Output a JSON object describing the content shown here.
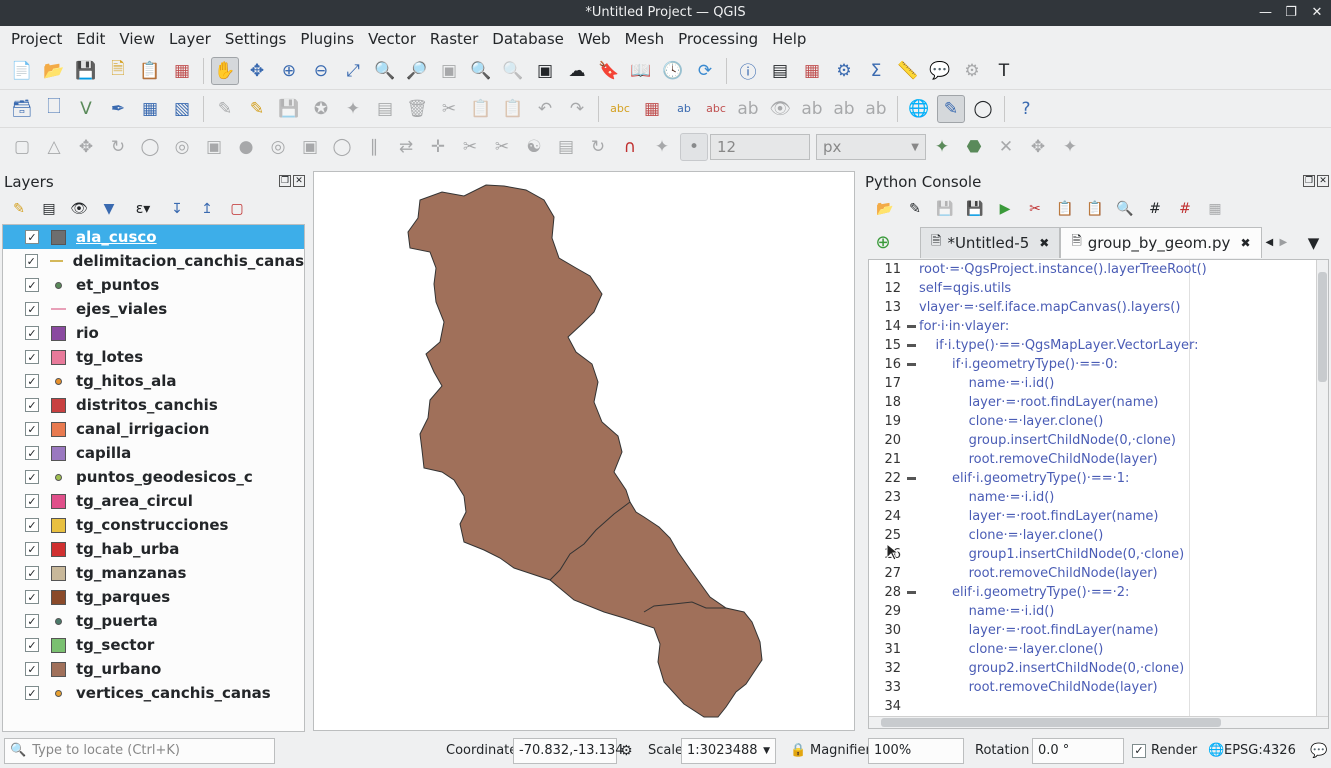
{
  "window": {
    "title": "*Untitled Project — QGIS"
  },
  "menu": [
    "Project",
    "Edit",
    "View",
    "Layer",
    "Settings",
    "Plugins",
    "Vector",
    "Raster",
    "Database",
    "Web",
    "Mesh",
    "Processing",
    "Help"
  ],
  "toolbar3": {
    "size_value": "12",
    "unit_value": "px"
  },
  "layers_panel": {
    "title": "Layers",
    "items": [
      {
        "name": "ala_cusco",
        "symbol": "fill",
        "color": "#6e6e6e",
        "selected": true
      },
      {
        "name": "delimitacion_canchis_canas",
        "symbol": "line",
        "color": "#d4b85a"
      },
      {
        "name": "et_puntos",
        "symbol": "point",
        "color": "#5a8a5a"
      },
      {
        "name": "ejes_viales",
        "symbol": "line",
        "color": "#e8a0b8"
      },
      {
        "name": "rio",
        "symbol": "fill",
        "color": "#8a4aa0"
      },
      {
        "name": "tg_lotes",
        "symbol": "fill",
        "color": "#e87a9a"
      },
      {
        "name": "tg_hitos_ala",
        "symbol": "point",
        "color": "#e8902a"
      },
      {
        "name": "distritos_canchis",
        "symbol": "fill",
        "color": "#c84040"
      },
      {
        "name": "canal_irrigacion",
        "symbol": "fill",
        "color": "#e87a50"
      },
      {
        "name": "capilla",
        "symbol": "fill",
        "color": "#9a78c0"
      },
      {
        "name": "puntos_geodesicos_c",
        "symbol": "point",
        "color": "#a0c050"
      },
      {
        "name": "tg_area_circul",
        "symbol": "fill",
        "color": "#e0508a"
      },
      {
        "name": "tg_construcciones",
        "symbol": "fill",
        "color": "#e8c040"
      },
      {
        "name": "tg_hab_urba",
        "symbol": "fill",
        "color": "#d03030"
      },
      {
        "name": "tg_manzanas",
        "symbol": "fill",
        "color": "#c8b89a"
      },
      {
        "name": "tg_parques",
        "symbol": "fill",
        "color": "#8a4a2a"
      },
      {
        "name": "tg_puerta",
        "symbol": "point",
        "color": "#4a7a6a"
      },
      {
        "name": "tg_sector",
        "symbol": "fill",
        "color": "#7ac070"
      },
      {
        "name": "tg_urbano",
        "symbol": "fill",
        "color": "#a0705a"
      },
      {
        "name": "vertices_canchis_canas",
        "symbol": "point",
        "color": "#e8a030"
      }
    ]
  },
  "map": {
    "polygon_color": "#a0705a"
  },
  "console": {
    "title": "Python Console",
    "tabs": [
      {
        "label": "*Untitled-5",
        "active": false
      },
      {
        "label": "group_by_geom.py",
        "active": true
      }
    ],
    "lines": [
      {
        "n": "11",
        "fold": false,
        "code": "root·=·QgsProject.instance().layerTreeRoot()"
      },
      {
        "n": "12",
        "fold": false,
        "code": "self=qgis.utils"
      },
      {
        "n": "13",
        "fold": false,
        "code": "vlayer·=·self.iface.mapCanvas().layers()"
      },
      {
        "n": "14",
        "fold": true,
        "code": "for·i·in·vlayer:"
      },
      {
        "n": "15",
        "fold": true,
        "code": "    if·i.type()·==·QgsMapLayer.VectorLayer:"
      },
      {
        "n": "16",
        "fold": true,
        "code": "        if·i.geometryType()·==·0:"
      },
      {
        "n": "17",
        "fold": false,
        "code": "            name·=·i.id()"
      },
      {
        "n": "18",
        "fold": false,
        "code": "            layer·=·root.findLayer(name)"
      },
      {
        "n": "19",
        "fold": false,
        "code": "            clone·=·layer.clone()"
      },
      {
        "n": "20",
        "fold": false,
        "code": "            group.insertChildNode(0,·clone)"
      },
      {
        "n": "21",
        "fold": false,
        "code": "            root.removeChildNode(layer)"
      },
      {
        "n": "22",
        "fold": true,
        "code": "        elif·i.geometryType()·==·1:"
      },
      {
        "n": "23",
        "fold": false,
        "code": "            name·=·i.id()"
      },
      {
        "n": "24",
        "fold": false,
        "code": "            layer·=·root.findLayer(name)"
      },
      {
        "n": "25",
        "fold": false,
        "code": "            clone·=·layer.clone()"
      },
      {
        "n": "26",
        "fold": false,
        "code": "            group1.insertChildNode(0,·clone)"
      },
      {
        "n": "27",
        "fold": false,
        "code": "            root.removeChildNode(layer)"
      },
      {
        "n": "28",
        "fold": true,
        "code": "        elif·i.geometryType()·==·2:"
      },
      {
        "n": "29",
        "fold": false,
        "code": "            name·=·i.id()"
      },
      {
        "n": "30",
        "fold": false,
        "code": "            layer·=·root.findLayer(name)"
      },
      {
        "n": "31",
        "fold": false,
        "code": "            clone·=·layer.clone()"
      },
      {
        "n": "32",
        "fold": false,
        "code": "            group2.insertChildNode(0,·clone)"
      },
      {
        "n": "33",
        "fold": false,
        "code": "            root.removeChildNode(layer)"
      },
      {
        "n": "34",
        "fold": false,
        "code": ""
      }
    ]
  },
  "statusbar": {
    "locate_placeholder": "Type to locate (Ctrl+K)",
    "coordinate_label": "Coordinate",
    "coordinate_value": "-70.832,-13.134",
    "scale_label": "Scale",
    "scale_value": "1:3023488",
    "magnifier_label": "Magnifier",
    "magnifier_value": "100%",
    "rotation_label": "Rotation",
    "rotation_value": "0.0 °",
    "render_label": "Render",
    "crs": "EPSG:4326"
  }
}
